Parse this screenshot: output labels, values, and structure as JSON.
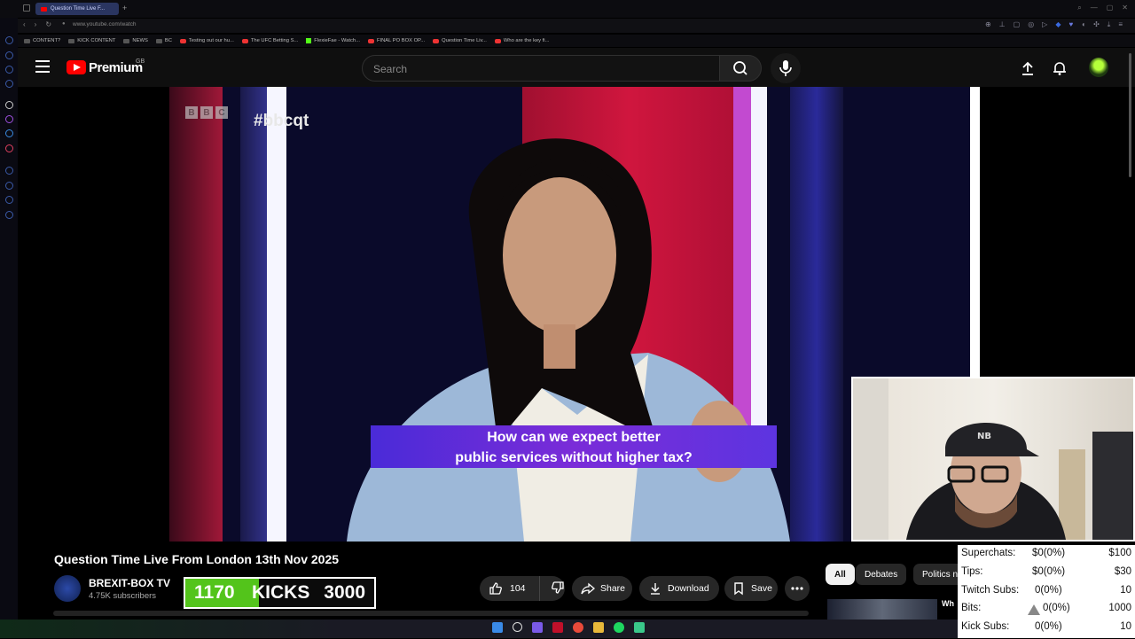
{
  "browser": {
    "tab_title": "Question Time Live F...",
    "url": "www.youtube.com/watch",
    "bookmarks": [
      {
        "label": "CONTENT?",
        "kind": "folder"
      },
      {
        "label": "KICK CONTENT",
        "kind": "folder"
      },
      {
        "label": "NEWS",
        "kind": "folder"
      },
      {
        "label": "BC",
        "kind": "folder"
      },
      {
        "label": "Testing out our hu...",
        "kind": "yt"
      },
      {
        "label": "The UFC Betting S...",
        "kind": "yt"
      },
      {
        "label": "FlexieFae - Watch...",
        "kind": "kick"
      },
      {
        "label": "FINAL PO BOX OP...",
        "kind": "yt"
      },
      {
        "label": "Question Time Liv...",
        "kind": "yt"
      },
      {
        "label": "Who are the key fi...",
        "kind": "yt"
      }
    ]
  },
  "header": {
    "brand": "Premium",
    "country": "GB",
    "search_placeholder": "Search"
  },
  "video": {
    "bbc_letters": [
      "B",
      "B",
      "C"
    ],
    "hashtag": "#bbcqt",
    "caption_line1": "How can we expect better",
    "caption_line2": "public services without higher tax?"
  },
  "meta": {
    "title": "Question Time Live From London 13th Nov 2025",
    "channel_name": "BREXIT-BOX TV",
    "subscribers": "4.75K subscribers",
    "like_count": "104",
    "share_label": "Share",
    "download_label": "Download",
    "save_label": "Save"
  },
  "kicks": {
    "current": 1170,
    "label": "KICKS",
    "goal": 3000,
    "fill_color": "#53c41b"
  },
  "chips": {
    "all": "All",
    "debates": "Debates",
    "politics": "Politics n"
  },
  "recommended": {
    "title_fragment": "Wh"
  },
  "stats": {
    "rows": [
      {
        "label": "Superchats:",
        "value": "$0(0%)",
        "goal": "$100"
      },
      {
        "label": "Tips:",
        "value": "$0(0%)",
        "goal": "$30"
      },
      {
        "label": "Twitch Subs:",
        "value": "0(0%)",
        "goal": "10"
      },
      {
        "label": "Bits:",
        "value": "0(0%)",
        "goal": "1000"
      },
      {
        "label": "Kick Subs:",
        "value": "0(0%)",
        "goal": "10"
      }
    ]
  },
  "colors": {
    "youtube_red": "#ff0000",
    "caption_purple": "#6a2ed8",
    "kick_green": "#53c41b"
  }
}
